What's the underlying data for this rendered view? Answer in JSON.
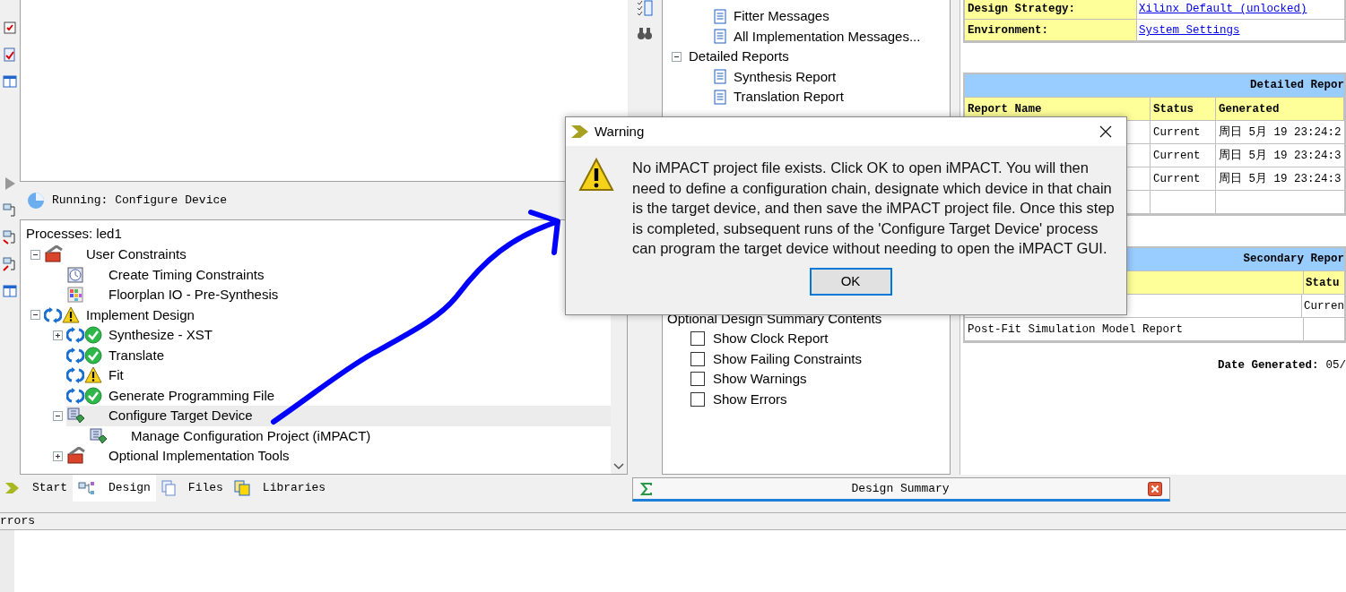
{
  "left_panel": {
    "running_bar": {
      "text": "Running: Configure Device"
    },
    "processes": {
      "title": "Processes: led1",
      "items": [
        {
          "label": "User Constraints",
          "kind": "toolbox",
          "expanded": true,
          "selected": false,
          "children": [
            {
              "label": "Create Timing Constraints",
              "kind": "clock",
              "selected": false
            },
            {
              "label": "Floorplan IO - Pre-Synthesis",
              "kind": "grid",
              "selected": false
            }
          ]
        },
        {
          "label": "Implement Design",
          "kind": "warning",
          "expanded": true,
          "selected": false,
          "children": [
            {
              "label": "Synthesize - XST",
              "kind": "passed",
              "expanded": false,
              "selected": false
            },
            {
              "label": "Translate",
              "kind": "passed",
              "selected": false
            },
            {
              "label": "Fit",
              "kind": "warning",
              "selected": false
            },
            {
              "label": "Generate Programming File",
              "kind": "passed",
              "selected": false
            },
            {
              "label": "Configure Target Device",
              "kind": "device",
              "expanded": true,
              "selected": true,
              "children": [
                {
                  "label": "Manage Configuration Project (iMPACT)",
                  "kind": "device",
                  "selected": false
                }
              ]
            },
            {
              "label": "Optional Implementation Tools",
              "kind": "toolbox",
              "expanded": false,
              "selected": false
            }
          ]
        }
      ]
    }
  },
  "middle_panel": {
    "message_items": [
      "Fitter Messages",
      "All Implementation Messages..."
    ],
    "detailed_reports": {
      "label": "Detailed Reports",
      "expanded": true,
      "children": [
        "Synthesis Report",
        "Translation Report"
      ]
    },
    "summary_options": {
      "label": "Optional Design Summary Contents",
      "options": [
        {
          "label": "Show Clock Report",
          "checked": false
        },
        {
          "label": "Show Failing Constraints",
          "checked": false
        },
        {
          "label": "Show Warnings",
          "checked": false
        },
        {
          "label": "Show Errors",
          "checked": false
        }
      ]
    }
  },
  "summary": {
    "properties": [
      {
        "label": "Design Strategy:",
        "value": "Xilinx Default (unlocked)"
      },
      {
        "label": "Environment:",
        "value": "System Settings"
      }
    ],
    "detailed_reports": {
      "title": "Detailed Repor",
      "columns": [
        "Report Name",
        "Status",
        "Generated"
      ],
      "rows": [
        {
          "status": "Current",
          "generated": "周日 5月 19 23:24:2"
        },
        {
          "status": "Current",
          "generated": "周日 5月 19 23:24:3"
        },
        {
          "status": "Current",
          "generated": "周日 5月 19 23:24:3"
        },
        {}
      ]
    },
    "secondary_reports": {
      "title": "Secondary Repor",
      "status_column": "Statu",
      "rows": [
        {
          "status": "Curren"
        },
        {
          "name": "Post-Fit Simulation Model Report"
        }
      ]
    },
    "date_generated": {
      "label": "Date Generated:",
      "value": "05/"
    }
  },
  "dialog": {
    "title": "Warning",
    "message": "No iMPACT project file exists. Click OK to open iMPACT. You will then need to define a configuration chain, designate which device in that chain is the target device, and then save the iMPACT project file. Once this step is completed, subsequent runs of the 'Configure Target Device' process can program the target device without needing to open the iMPACT GUI.",
    "button": {
      "label": "OK",
      "focused": true
    }
  },
  "left_tabs": [
    {
      "label": "Start",
      "kind": "start",
      "selected": false
    },
    {
      "label": "Design",
      "kind": "design",
      "selected": true
    },
    {
      "label": "Files",
      "kind": "files",
      "selected": false
    },
    {
      "label": "Libraries",
      "kind": "libraries",
      "selected": false
    }
  ],
  "document_tabs": [
    {
      "label": "Design Summary",
      "selected": true
    }
  ],
  "console": {
    "title": "rrors"
  }
}
